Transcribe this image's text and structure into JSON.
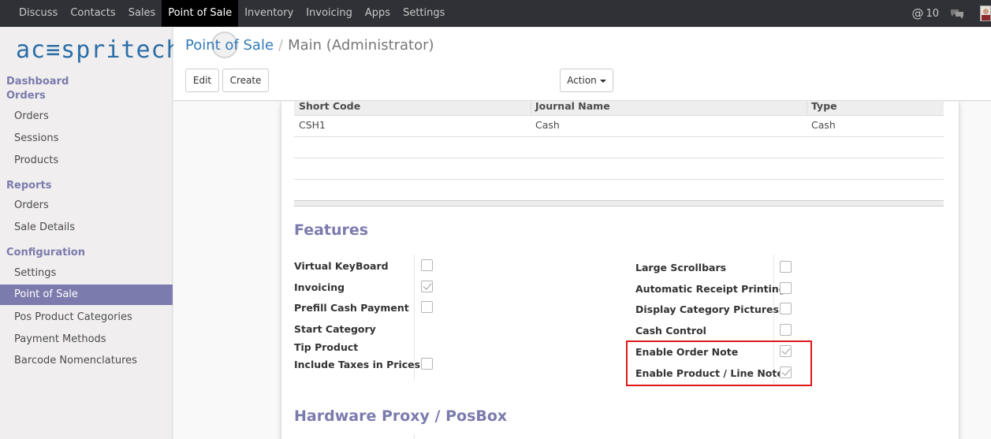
{
  "topbar": {
    "menu": [
      "Discuss",
      "Contacts",
      "Sales",
      "Point of Sale",
      "Inventory",
      "Invoicing",
      "Apps",
      "Settings"
    ],
    "active": "Point of Sale",
    "messages_count": "10"
  },
  "sidebar": {
    "logo": "ac≡spritech",
    "dashboard": "Dashboard",
    "orders_section": "Orders",
    "orders_items": [
      "Orders",
      "Sessions",
      "Products"
    ],
    "reports_section": "Reports",
    "reports_items": [
      "Orders",
      "Sale Details"
    ],
    "config_section": "Configuration",
    "config_items": [
      "Settings",
      "Point of Sale",
      "Pos Product Categories",
      "Payment Methods",
      "Barcode Nomenclatures"
    ],
    "active_item": "Point of Sale"
  },
  "control_panel": {
    "breadcrumb_link": "Point of Sale",
    "breadcrumb_sep": "/",
    "breadcrumb_current": "Main (Administrator)",
    "edit_label": "Edit",
    "create_label": "Create",
    "action_label": "Action"
  },
  "journals": {
    "columns": [
      "Short Code",
      "Journal Name",
      "Type"
    ],
    "rows": [
      [
        "CSH1",
        "Cash",
        "Cash"
      ]
    ]
  },
  "features": {
    "title": "Features",
    "left": [
      {
        "label": "Virtual KeyBoard",
        "checked": false,
        "has_checkbox": true
      },
      {
        "label": "Invoicing",
        "checked": true,
        "has_checkbox": true
      },
      {
        "label": "Prefill Cash Payment",
        "checked": false,
        "has_checkbox": true
      },
      {
        "label": "Start Category",
        "has_checkbox": false
      },
      {
        "label": "Tip Product",
        "has_checkbox": false
      },
      {
        "label": "Include Taxes in Prices",
        "checked": false,
        "has_checkbox": true
      }
    ],
    "right": [
      {
        "label": "Large Scrollbars",
        "checked": false
      },
      {
        "label": "Automatic Receipt Printing",
        "checked": false
      },
      {
        "label": "Display Category Pictures",
        "checked": false
      },
      {
        "label": "Cash Control",
        "checked": false
      },
      {
        "label": "Enable Order Note",
        "checked": true
      },
      {
        "label": "Enable Product / Line Note",
        "checked": true
      }
    ]
  },
  "hardware": {
    "title": "Hardware Proxy / PosBox"
  },
  "colors": {
    "navbar": "#2f3136",
    "accent": "#7c7bad",
    "link": "#337ab7",
    "highlight": "#e01818"
  }
}
